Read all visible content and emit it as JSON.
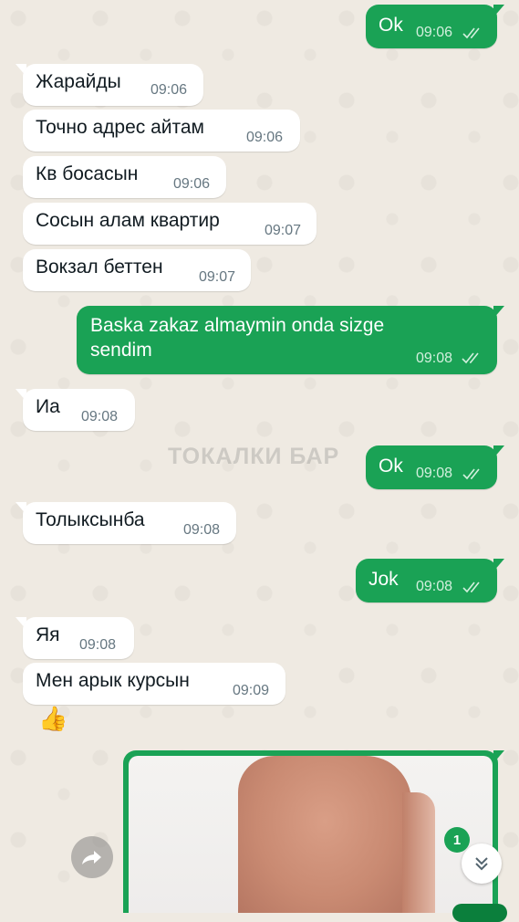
{
  "watermark": "ТОКАЛКИ БАР",
  "messages": [
    {
      "text": "Ok",
      "time": "09:06"
    },
    {
      "text": "Жарайды",
      "time": "09:06"
    },
    {
      "text": "Точно адрес айтам",
      "time": "09:06"
    },
    {
      "text": "Кв босасын",
      "time": "09:06"
    },
    {
      "text": "Сосын алам квартир",
      "time": "09:07"
    },
    {
      "text": "Вокзал беттен",
      "time": "09:07"
    },
    {
      "text": "Baska zakaz almaymin onda sizge",
      "text2": "sendim",
      "time": "09:08"
    },
    {
      "text": "Иа",
      "time": "09:08"
    },
    {
      "text": "Ok",
      "time": "09:08"
    },
    {
      "text": "Толыксынба",
      "time": "09:08"
    },
    {
      "text": "Jok",
      "time": "09:08"
    },
    {
      "text": "Яя",
      "time": "09:08"
    },
    {
      "text": "Мен арык курсын",
      "time": "09:09"
    },
    {
      "text": "👍"
    }
  ],
  "unread_count": "1",
  "colors": {
    "outgoing": "#1aa255",
    "incoming": "#ffffff",
    "wallpaper": "#efeae2"
  },
  "icons": {
    "read": "double-check-icon",
    "forward": "forward-icon",
    "scroll": "chevron-down-double-icon"
  }
}
